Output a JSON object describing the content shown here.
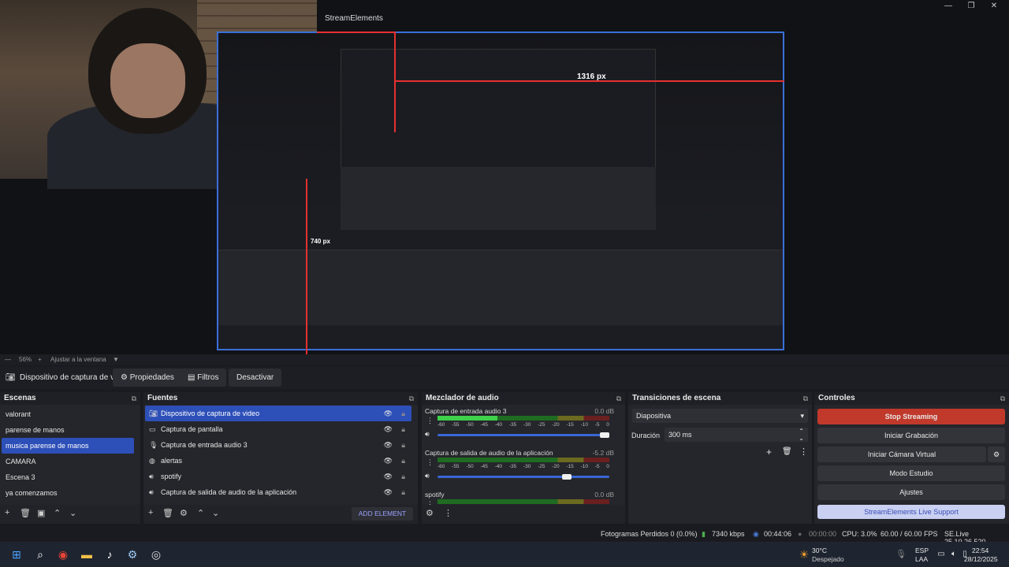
{
  "window": {
    "title": "StreamElements"
  },
  "preview": {
    "nested_labels": {
      "width_px": "1316 px",
      "height_px": "740 px"
    }
  },
  "zoom_bar": {
    "zoom": "56%",
    "fit_label": "Ajustar a la ventana"
  },
  "source_toolbar": {
    "source_name": "Dispositivo de captura de v",
    "properties": "Propiedades",
    "filters": "Filtros",
    "deactivate": "Desactivar"
  },
  "scenes": {
    "title": "Escenas",
    "items": [
      "valorant",
      "parense de manos",
      "musica parense de manos",
      "CAMARA",
      "Escena 3",
      "ya comenzamos"
    ],
    "selected_index": 2
  },
  "sources": {
    "title": "Fuentes",
    "items": [
      {
        "label": "Dispositivo de captura de video",
        "icon": "camera-icon"
      },
      {
        "label": "Captura de pantalla",
        "icon": "monitor-icon"
      },
      {
        "label": "Captura de entrada audio 3",
        "icon": "microphone-icon"
      },
      {
        "label": "alertas",
        "icon": "browser-icon"
      },
      {
        "label": "spotify",
        "icon": "speaker-icon"
      },
      {
        "label": "Captura de salida de audio de la aplicación",
        "icon": "speaker-icon"
      }
    ],
    "add_element": "ADD ELEMENT"
  },
  "mixer": {
    "title": "Mezclador de audio",
    "channels": [
      {
        "name": "Captura de entrada audio 3",
        "db": "0.0 dB",
        "level": 0.35,
        "volume": 1.0
      },
      {
        "name": "Captura de salida de audio de la aplicación",
        "db": "-5.2 dB",
        "level": 0.0,
        "volume": 0.78
      },
      {
        "name": "spotify",
        "db": "0.0 dB",
        "level": 0.0,
        "volume": 1.0
      }
    ],
    "ticks": [
      "-60",
      "-55",
      "-50",
      "-45",
      "-40",
      "-35",
      "-30",
      "-25",
      "-20",
      "-15",
      "-10",
      "-5",
      "0"
    ]
  },
  "transitions": {
    "title": "Transiciones de escena",
    "selected": "Diapositiva",
    "duration_label": "Duración",
    "duration_value": "300 ms"
  },
  "controls": {
    "title": "Controles",
    "stop_streaming": "Stop Streaming",
    "start_recording": "Iniciar Grabación",
    "start_virtual_camera": "Iniciar Cámara Virtual",
    "studio_mode": "Modo Estudio",
    "settings": "Ajustes",
    "support": "StreamElements Live Support",
    "colors": {
      "stop": "#c0392b",
      "support": "#c9d0f2",
      "support_text": "#3a4cb5"
    }
  },
  "statusbar": {
    "dropped_frames": "Fotogramas Perdidos 0 (0.0%)",
    "bitrate": "7340 kbps",
    "live_time": "00:44:06",
    "rec_time": "00:00:00",
    "cpu": "CPU: 3.0%",
    "fps": "60.00 / 60.00 FPS",
    "version": "SE.Live 25.10.26.520"
  },
  "taskbar": {
    "weather_temp": "30°C",
    "weather_desc": "Despejado",
    "lang": "ESP",
    "lang_sub": "LAA",
    "time": "22:54",
    "date": "28/12/2025"
  }
}
